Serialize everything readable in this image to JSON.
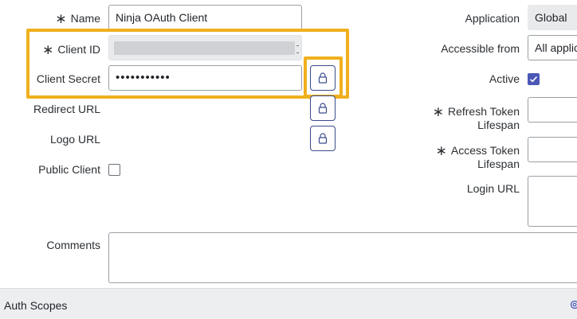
{
  "form": {
    "name": {
      "label": "Name",
      "value": "Ninja OAuth Client"
    },
    "client_id": {
      "label": "Client ID"
    },
    "client_secret": {
      "label": "Client Secret",
      "value": "•••••••••••"
    },
    "redirect_url": {
      "label": "Redirect URL"
    },
    "logo_url": {
      "label": "Logo URL"
    },
    "public_client": {
      "label": "Public Client",
      "checked": false
    },
    "comments": {
      "label": "Comments"
    },
    "required_marker": "∗"
  },
  "right": {
    "application": {
      "label": "Application",
      "value": "Global"
    },
    "accessible_from": {
      "label": "Accessible from",
      "value": "All applic"
    },
    "active": {
      "label": "Active",
      "checked": true
    },
    "refresh_token": {
      "label_line1": "Refresh Token",
      "label_line2": "Lifespan"
    },
    "access_token": {
      "label_line1": "Access Token",
      "label_line2": "Lifespan"
    },
    "login_url": {
      "label": "Login URL"
    }
  },
  "footer": {
    "title": "Auth Scopes"
  },
  "colors": {
    "highlight": "#f0b01e",
    "accent": "#4b57b6",
    "lock_border": "#3b4a8c"
  }
}
